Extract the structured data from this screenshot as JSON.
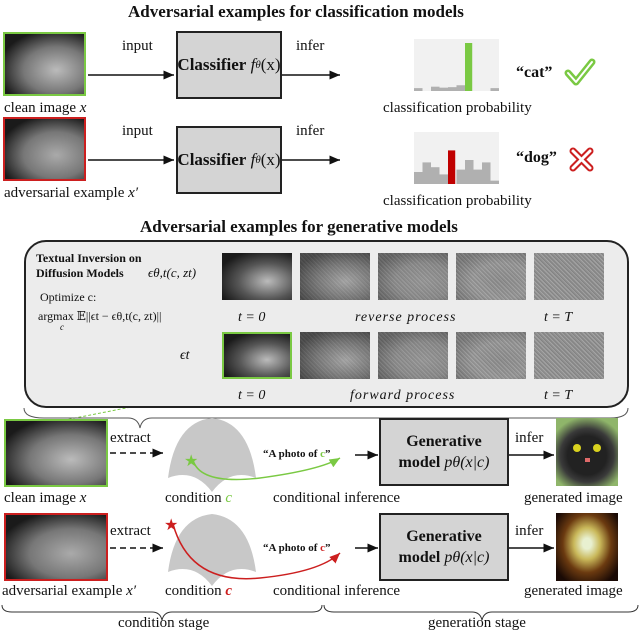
{
  "classification": {
    "title": "Adversarial examples for classification models",
    "rows": [
      {
        "image_label": "clean image ",
        "image_var": "x",
        "border_color": "#7ac943",
        "input_label": "input",
        "classifier_label": "Classifier ",
        "classifier_fn": "f",
        "classifier_sub": "θ",
        "classifier_arg": "(x)",
        "infer_label": "infer",
        "prob_label": "classification probability",
        "prediction": "“cat”",
        "result_icon": "check-icon",
        "result_color": "#7ac943",
        "bars": [
          0.06,
          0.0,
          0.09,
          0.07,
          0.08,
          0.12,
          1.0,
          0.0,
          0.0,
          0.06
        ],
        "highlight_index": 6,
        "highlight_color": "#7ac943"
      },
      {
        "image_label": "adversarial example ",
        "image_var": "x′",
        "border_color": "#cc1f1f",
        "input_label": "input",
        "classifier_label": "Classifier ",
        "classifier_fn": "f",
        "classifier_sub": "θ",
        "classifier_arg": "(x)",
        "infer_label": "infer",
        "prob_label": "classification probability",
        "prediction": "“dog”",
        "result_icon": "cross-icon",
        "result_color": "#cc1f1f",
        "bars": [
          0.25,
          0.45,
          0.35,
          0.2,
          0.7,
          0.3,
          0.5,
          0.3,
          0.45,
          0.07
        ],
        "highlight_index": 4,
        "highlight_color": "#c00000"
      }
    ]
  },
  "generative": {
    "title": "Adversarial examples for generative models",
    "panel": {
      "heading_line1": "Textual Inversion on",
      "heading_line2": "Diffusion Models",
      "eps_model": "ϵθ,t(c, zt)",
      "optimize": "Optimize c:",
      "objective": "argmax 𝔼||ϵt − ϵθ,t(c, zt)||",
      "objective_sub": "c",
      "eps_t": "ϵt",
      "reverse_t0": "t = 0",
      "reverse_label": "reverse process",
      "reverse_tT": "t = T",
      "forward_t0": "t = 0",
      "forward_label": "forward process",
      "forward_tT": "t = T",
      "noise_levels": [
        0.0,
        0.25,
        0.5,
        0.75,
        1.0
      ]
    },
    "rows": [
      {
        "image_label": "clean image ",
        "image_var": "x",
        "border_color": "#7ac943",
        "extract_label": "extract",
        "condition_label": "condition ",
        "condition_var": "c",
        "condition_color": "#7ac943",
        "prompt_prefix": "“A photo of ",
        "prompt_var": "c",
        "prompt_suffix": "”",
        "model_line1": "Generative",
        "model_line2": "model ",
        "model_fn": "pθ(x|c)",
        "cond_inference_label": "conditional inference",
        "infer_label": "infer",
        "output_label": "generated image"
      },
      {
        "image_label": "adversarial example ",
        "image_var": "x′",
        "border_color": "#cc1f1f",
        "extract_label": "extract",
        "condition_label": "condition ",
        "condition_var": "c",
        "condition_color": "#cc1f1f",
        "prompt_prefix": "“A photo of ",
        "prompt_var": "c",
        "prompt_suffix": "”",
        "model_line1": "Generative",
        "model_line2": "model ",
        "model_fn": "pθ(x|c)",
        "cond_inference_label": "conditional inference",
        "infer_label": "infer",
        "output_label": "generated image"
      }
    ],
    "stages": {
      "condition": "condition stage",
      "generation": "generation stage"
    }
  }
}
